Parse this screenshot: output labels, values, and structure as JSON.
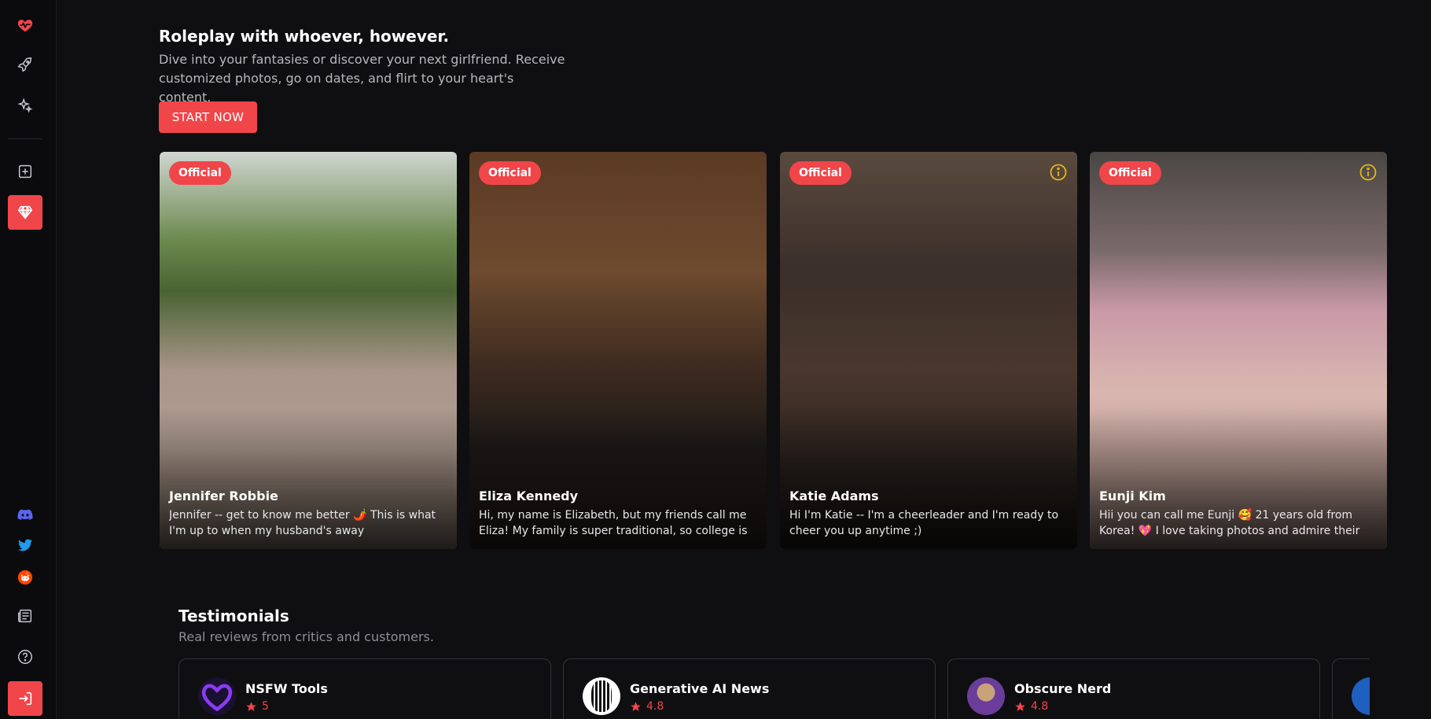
{
  "sidebar": {
    "icons": [
      "heart-pulse-icon",
      "rocket-icon",
      "sparkles-icon",
      "plus-square-icon",
      "gem-icon",
      "discord-icon",
      "twitter-icon",
      "reddit-icon",
      "newspaper-icon",
      "help-circle-icon",
      "login-icon"
    ],
    "active_item": "gem-icon",
    "accent": "#f0464a"
  },
  "hero": {
    "title": "Roleplay with whoever, however.",
    "subtitle": "Dive into your fantasies or discover your next girlfriend. Receive customized photos, go on dates, and flirt to your heart's content.",
    "cta_label": "START NOW"
  },
  "cards": [
    {
      "badge": "Official",
      "name": "Jennifer Robbie",
      "desc": "Jennifer -- get to know me better 🌶️ This is what I'm up to when my husband's away",
      "info_icon": false
    },
    {
      "badge": "Official",
      "name": "Eliza Kennedy",
      "desc": "Hi, my name is Elizabeth, but my friends call me Eliza! My family is super traditional, so college is a whole...",
      "info_icon": false
    },
    {
      "badge": "Official",
      "name": "Katie Adams",
      "desc": "Hi I'm Katie -- I'm a cheerleader and I'm ready to cheer you up anytime ;)",
      "info_icon": true
    },
    {
      "badge": "Official",
      "name": "Eunji Kim",
      "desc": "Hii you can call me Eunji 🥰 21 years old from Korea! 💖 I love taking photos and admire their beauty....",
      "info_icon": true
    }
  ],
  "testimonials": {
    "title": "Testimonials",
    "subtitle": "Real reviews from critics and customers.",
    "items": [
      {
        "name": "NSFW Tools",
        "rating": "5"
      },
      {
        "name": "Generative AI News",
        "rating": "4.8"
      },
      {
        "name": "Obscure Nerd",
        "rating": "4.8"
      },
      {
        "name": "",
        "rating": ""
      }
    ]
  }
}
